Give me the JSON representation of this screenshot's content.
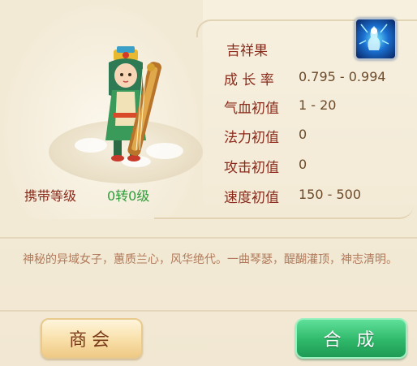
{
  "pet": {
    "name": "吉祥果",
    "carry_label": "携带等级",
    "carry_value": "0转0级"
  },
  "stats": [
    {
      "label": "成 长 率",
      "value": "0.795 - 0.994"
    },
    {
      "label": "气血初值",
      "value": "1 - 20"
    },
    {
      "label": "法力初值",
      "value": "0"
    },
    {
      "label": "攻击初值",
      "value": "0"
    },
    {
      "label": "速度初值",
      "value": "150 - 500"
    }
  ],
  "description": "神秘的异域女子，蕙质兰心，风华绝代。一曲琴瑟，醍醐灌顶，神志清明。",
  "buttons": {
    "shop": "商会",
    "merge": "合 成"
  },
  "icons": {
    "skill": "blue-spirit-skill-icon"
  },
  "colors": {
    "label": "#8a2a1a",
    "carry_value": "#2f9b3a",
    "merge_button": "#2fb86a",
    "shop_button": "#f8dfa8"
  }
}
